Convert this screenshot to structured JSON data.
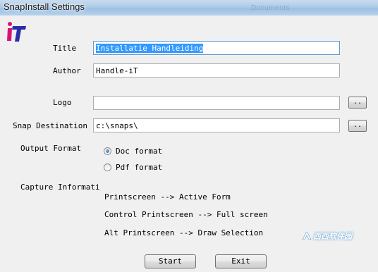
{
  "window": {
    "title": "SnapInstall Settings",
    "title_ghost": "Documents"
  },
  "logo": {
    "text": "iT",
    "colors": {
      "i": "#d4147a",
      "T": "#2a2fa8"
    }
  },
  "form": {
    "title_label": "Title",
    "title_value": "Installatie Handleiding",
    "author_label": "Author",
    "author_value": "Handle-iT",
    "logo_label": "Logo",
    "logo_value": "",
    "logo_browse": "..",
    "dest_label": "Snap Destination",
    "dest_value": "c:\\snaps\\",
    "dest_browse": ".."
  },
  "output_format": {
    "label": "Output Format",
    "options": [
      {
        "label": "Doc format",
        "selected": true
      },
      {
        "label": "Pdf format",
        "selected": false
      }
    ]
  },
  "capture": {
    "label": "Capture Informati",
    "lines": [
      "Printscreen --> Active Form",
      "Control Printscreen --> Full screen",
      "Alt Printscreen --> Draw Selection"
    ]
  },
  "buttons": {
    "start": "Start",
    "exit": "Exit"
  },
  "watermark": {
    "text": "西西软件园"
  },
  "colors": {
    "selection": "#3399ff",
    "window_bg": "#f0f0f0"
  }
}
